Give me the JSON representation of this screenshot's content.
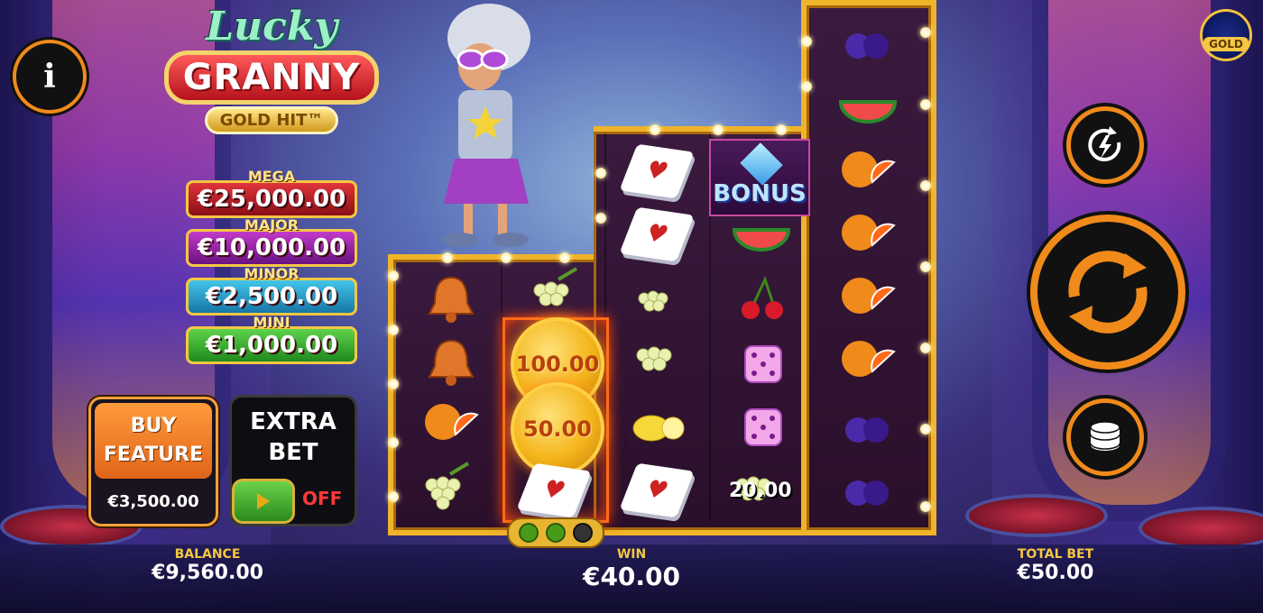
{
  "logo": {
    "line1": "Lucky",
    "line2": "GRANNY",
    "line3": "GOLD HIT™"
  },
  "jackpots": [
    {
      "label": "MEGA",
      "value": "€25,000.00",
      "color": "#e0343b"
    },
    {
      "label": "MAJOR",
      "value": "€10,000.00",
      "color": "#c23bc9"
    },
    {
      "label": "MINOR",
      "value": "€2,500.00",
      "color": "#43c5e8"
    },
    {
      "label": "MINI",
      "value": "€1,000.00",
      "color": "#5ed24a"
    }
  ],
  "info_button": {
    "label": "i"
  },
  "buy_feature": {
    "line1": "BUY",
    "line2": "FEATURE",
    "price": "€3,500.00"
  },
  "extra_bet": {
    "line1": "EXTRA",
    "line2": "BET",
    "state": "OFF"
  },
  "reels": {
    "coin_values": [
      "100.00",
      "50.00"
    ],
    "win_label": "20.00",
    "bonus_label": "BONUS",
    "indicator_dots": [
      true,
      true,
      false
    ],
    "columns": [
      [
        "bell",
        "bell",
        "orange",
        "grapes"
      ],
      [
        "grapes",
        "coin",
        "coin",
        "card"
      ],
      [
        "card",
        "card",
        "grapes",
        "grapes",
        "lemon",
        "card"
      ],
      [
        "bonus",
        "watermelon",
        "cherries",
        "dice",
        "dice",
        "grapes"
      ],
      [
        "plum",
        "watermelon",
        "orange",
        "orange",
        "orange",
        "orange",
        "plum",
        "plum"
      ]
    ]
  },
  "brand_badge": {
    "label": "GOLD"
  },
  "controls": {
    "autoplay_icon": "lightning-refresh-icon",
    "spin_icon": "spin-arrows-icon",
    "bet_icon": "coin-stack-icon"
  },
  "bottom": {
    "balance_label": "BALANCE",
    "balance_value": "€9,560.00",
    "win_label": "WIN",
    "win_value": "€40.00",
    "total_bet_label": "TOTAL BET",
    "total_bet_value": "€50.00"
  }
}
